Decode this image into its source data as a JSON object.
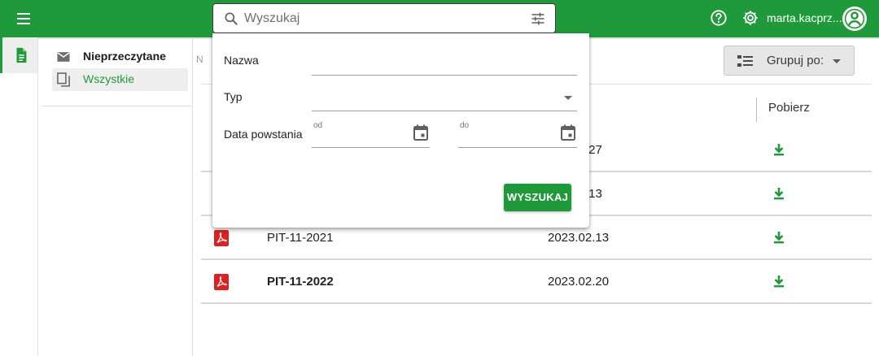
{
  "colors": {
    "brand": "#1e9a3a",
    "pdf": "#e02020"
  },
  "topbar": {
    "menu_icon": "hamburger-menu-icon",
    "search": {
      "placeholder": "Wyszukaj",
      "value": "",
      "icon": "search-icon",
      "filter_icon": "tune-icon"
    },
    "help_icon": "help-circle-icon",
    "settings_icon": "gear-icon",
    "user_name": "marta.kacprz...",
    "avatar_icon": "account-circle-icon"
  },
  "rail": {
    "items": [
      {
        "icon": "document-icon",
        "active": true
      }
    ]
  },
  "sidebar": {
    "items": [
      {
        "label": "Nieprzeczytane",
        "icon": "envelope-icon"
      },
      {
        "label": "Wszystkie",
        "icon": "copy-icon",
        "active": true
      }
    ]
  },
  "toolbar": {
    "group_label": "Grupuj po:",
    "group_icon": "group-list-icon"
  },
  "table": {
    "header_partial": "N",
    "columns": {
      "download": "Pobierz"
    },
    "rows": [
      {
        "name": "",
        "date": ".27",
        "icon": "pdf-icon",
        "bold": false
      },
      {
        "name": "",
        "date": ".13",
        "icon": "pdf-icon",
        "bold": false
      },
      {
        "name": "PIT-11-2021",
        "date": "2023.02.13",
        "icon": "pdf-icon",
        "bold": false
      },
      {
        "name": "PIT-11-2022",
        "date": "2023.02.20",
        "icon": "pdf-icon",
        "bold": true
      }
    ]
  },
  "search_panel": {
    "name_label": "Nazwa",
    "type_label": "Typ",
    "date_label": "Data powstania",
    "from_label": "od",
    "to_label": "do",
    "submit_label": "WYSZUKAJ"
  }
}
